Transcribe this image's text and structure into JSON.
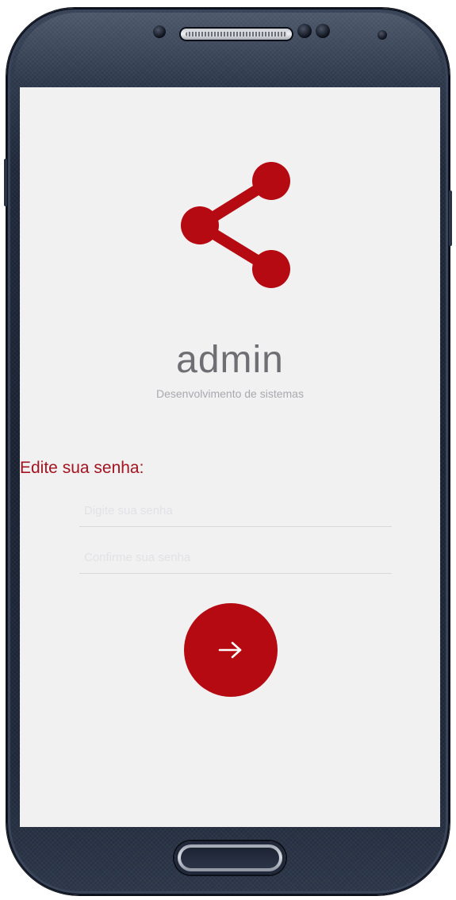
{
  "app": {
    "title": "admin",
    "subtitle": "Desenvolvimento de sistemas",
    "logo_icon": "share-icon",
    "accent_color": "#b50a12"
  },
  "form": {
    "label": "Edite sua senha:",
    "fields": [
      {
        "value": "",
        "placeholder": "Digite sua senha"
      },
      {
        "value": "",
        "placeholder": "Confirme sua senha"
      }
    ],
    "submit_icon": "arrow-right-icon"
  }
}
